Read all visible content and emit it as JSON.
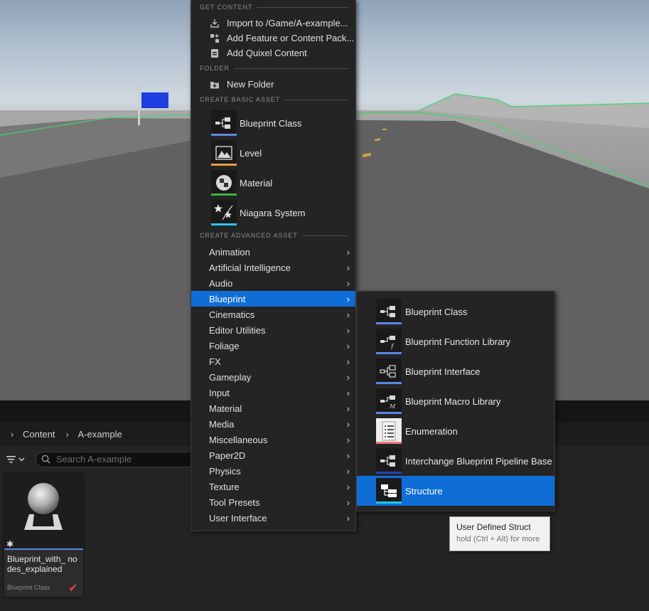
{
  "main_menu": {
    "sections": {
      "get_content": "GET CONTENT",
      "folder": "FOLDER",
      "create_basic_asset": "CREATE BASIC ASSET",
      "create_advanced_asset": "CREATE ADVANCED ASSET"
    },
    "get_content_items": [
      {
        "label": "Import to /Game/A-example...",
        "icon": "import-icon"
      },
      {
        "label": "Add Feature or Content Pack...",
        "icon": "feature-pack-icon"
      },
      {
        "label": "Add Quixel Content",
        "icon": "quixel-icon"
      }
    ],
    "folder_items": [
      {
        "label": "New Folder",
        "icon": "new-folder-icon"
      }
    ],
    "basic_assets": [
      {
        "label": "Blueprint Class",
        "icon": "blueprint-class-icon",
        "color": "#5a88e8"
      },
      {
        "label": "Level",
        "icon": "level-icon",
        "color": "#e8a23a"
      },
      {
        "label": "Material",
        "icon": "material-icon",
        "color": "#3fb34f"
      },
      {
        "label": "Niagara System",
        "icon": "niagara-icon",
        "color": "#27c5e8"
      }
    ],
    "advanced_categories": [
      "Animation",
      "Artificial Intelligence",
      "Audio",
      "Blueprint",
      "Cinematics",
      "Editor Utilities",
      "Foliage",
      "FX",
      "Gameplay",
      "Input",
      "Material",
      "Media",
      "Miscellaneous",
      "Paper2D",
      "Physics",
      "Texture",
      "Tool Presets",
      "User Interface"
    ],
    "active_category": "Blueprint"
  },
  "blueprint_submenu": {
    "items": [
      {
        "label": "Blueprint Class",
        "icon": "blueprint-class-icon",
        "color": "#5a88e8"
      },
      {
        "label": "Blueprint Function Library",
        "icon": "blueprint-function-library-icon",
        "color": "#5a88e8"
      },
      {
        "label": "Blueprint Interface",
        "icon": "blueprint-interface-icon",
        "color": "#5a88e8"
      },
      {
        "label": "Blueprint Macro Library",
        "icon": "blueprint-macro-library-icon",
        "color": "#5a88e8"
      },
      {
        "label": "Enumeration",
        "icon": "enumeration-icon",
        "color": "#e87a7a"
      },
      {
        "label": "Interchange Blueprint Pipeline Base",
        "icon": "interchange-pipeline-icon",
        "color": "#2540b0"
      },
      {
        "label": "Structure",
        "icon": "structure-icon",
        "color": "#27c5e8"
      }
    ],
    "highlighted": "Structure"
  },
  "tooltip": {
    "title": "User Defined Struct",
    "hint": "hold (Ctrl + Alt) for more"
  },
  "content_browser": {
    "breadcrumb": [
      "Content",
      "A-example"
    ],
    "search_placeholder": "Search A-example",
    "asset": {
      "name": "Blueprint_with_ nodes_explained",
      "type": "Blueprint Class"
    }
  },
  "colors": {
    "menu_bg": "#242424",
    "highlight": "#0f6ed6",
    "tooltip_bg": "#f1f1f1"
  }
}
